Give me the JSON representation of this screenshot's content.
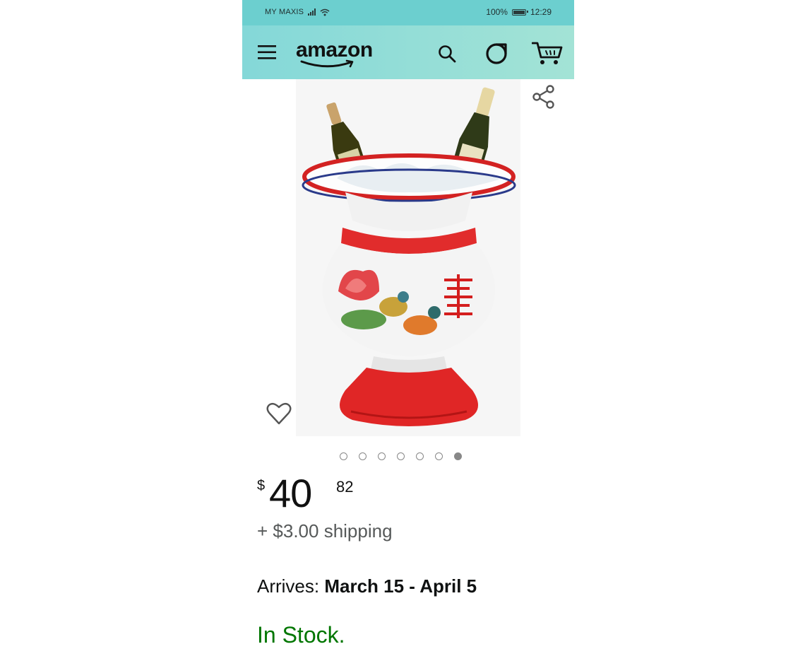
{
  "status_bar": {
    "carrier": "MY MAXIS",
    "battery_percent": "100%",
    "time": "12:29"
  },
  "header": {
    "logo_text": "amazon",
    "icons": [
      "menu-icon",
      "search-icon",
      "alexa-icon",
      "cart-icon"
    ]
  },
  "product": {
    "image_icons": [
      "share-icon",
      "heart-icon"
    ],
    "carousel": {
      "count": 7,
      "active_index": 6
    },
    "price": {
      "currency": "$",
      "whole": "40",
      "fraction": "82"
    },
    "shipping": "+ $3.00 shipping",
    "arrives_label": "Arrives:",
    "arrives_date": "March 15 - April 5",
    "stock": "In Stock."
  },
  "colors": {
    "status_bar": "#6ccfcf",
    "header_start": "#84d8d8",
    "header_end": "#a3e3d6",
    "in_stock": "#007600",
    "shipping_text": "#565959"
  }
}
